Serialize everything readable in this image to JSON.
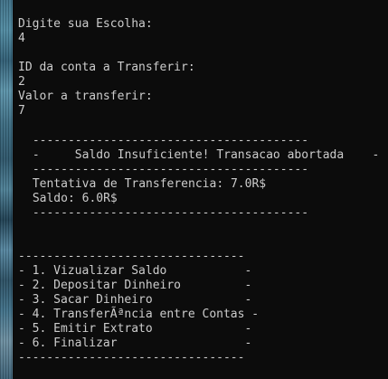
{
  "prompts": {
    "choice_label": "Digite sua Escolha:",
    "choice_value": "4",
    "account_label": "ID da conta a Transferir:",
    "account_value": "2",
    "amount_label": "Valor a transferir:",
    "amount_value": "7"
  },
  "transaction_box": {
    "top_border": " ---------------------------------------",
    "message": " -     Saldo Insuficiente! Transacao abortada    -",
    "mid_border": " ---------------------------------------",
    "attempt": " Tentativa de Transferencia: 7.0R$",
    "balance": " Saldo: 6.0R$",
    "bottom_border": " ---------------------------------------"
  },
  "menu": {
    "top_border": "--------------------------------",
    "items": [
      "- 1. Vizualizar Saldo           -",
      "- 2. Depositar Dinheiro         -",
      "- 3. Sacar Dinheiro             -",
      "- 4. TransferÃªncia entre Contas -",
      "- 5. Emitir Extrato             -",
      "- 6. Finalizar                  -"
    ],
    "bottom_border": "--------------------------------"
  }
}
